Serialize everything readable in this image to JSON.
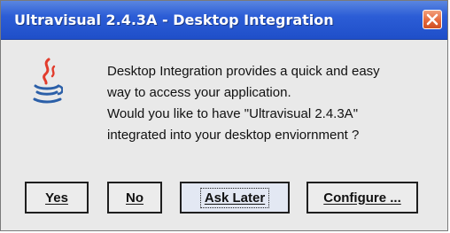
{
  "window": {
    "title": "Ultravisual 2.4.3A - Desktop Integration"
  },
  "message": {
    "line1": "Desktop Integration provides a quick and easy",
    "line2": "way to access your application.",
    "line3": "Would you like to have  \"Ultravisual 2.4.3A\"",
    "line4": "integrated into your desktop enviornment ?"
  },
  "buttons": {
    "yes": "Yes",
    "no": "No",
    "ask_later": "Ask Later",
    "configure": "Configure ..."
  },
  "colors": {
    "titlebar": "#2c5dd6",
    "close": "#e4683c",
    "dialog_bg": "#e9e9e9"
  },
  "icons": {
    "app": "java-coffee-cup-icon",
    "close": "close-icon"
  }
}
